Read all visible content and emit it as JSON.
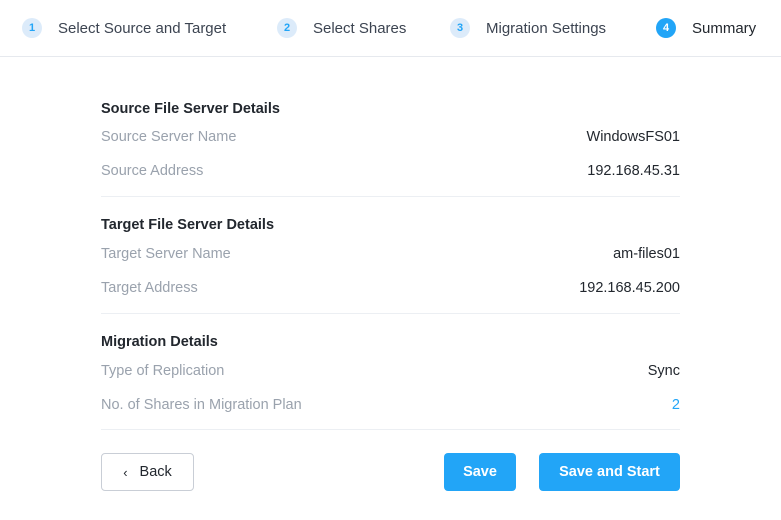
{
  "stepper": {
    "steps": [
      {
        "number": "1",
        "label": "Select Source and Target"
      },
      {
        "number": "2",
        "label": "Select Shares"
      },
      {
        "number": "3",
        "label": "Migration Settings"
      },
      {
        "number": "4",
        "label": "Summary",
        "active": true
      }
    ]
  },
  "summary": {
    "source": {
      "title": "Source File Server Details",
      "rows": [
        {
          "label": "Source Server Name",
          "value": "WindowsFS01"
        },
        {
          "label": "Source Address",
          "value": "192.168.45.31"
        }
      ]
    },
    "target": {
      "title": "Target File Server Details",
      "rows": [
        {
          "label": "Target Server Name",
          "value": "am-files01"
        },
        {
          "label": "Target Address",
          "value": "192.168.45.200"
        }
      ]
    },
    "migration": {
      "title": "Migration Details",
      "rows": [
        {
          "label": "Type of Replication",
          "value": "Sync"
        },
        {
          "label": "No. of Shares in Migration Plan",
          "value": "2"
        }
      ]
    }
  },
  "footer": {
    "back_icon": "‹",
    "back_label": "Back",
    "save_label": "Save",
    "save_start_label": "Save and Start"
  },
  "colors": {
    "accent": "#22a5f7",
    "muted_text": "#9aa2ad",
    "text": "#22272e"
  }
}
